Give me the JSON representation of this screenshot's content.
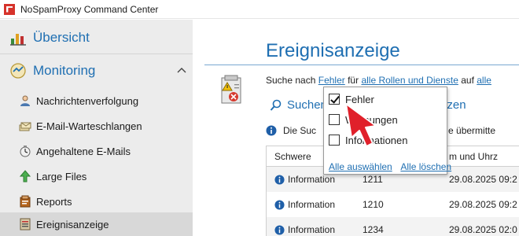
{
  "window": {
    "title": "NoSpamProxy Command Center"
  },
  "sidebar": {
    "overview": {
      "label": "Übersicht",
      "icon": "chart-icon"
    },
    "group": {
      "label": "Monitoring",
      "icon": "monitor-icon",
      "expanded": true
    },
    "items": [
      {
        "label": "Nachrichtenverfolgung",
        "icon": "message-tracking-icon",
        "active": false
      },
      {
        "label": "E-Mail-Warteschlangen",
        "icon": "mail-queue-icon",
        "active": false
      },
      {
        "label": "Angehaltene E-Mails",
        "icon": "held-mail-icon",
        "active": false
      },
      {
        "label": "Large Files",
        "icon": "large-files-icon",
        "active": false
      },
      {
        "label": "Reports",
        "icon": "reports-icon",
        "active": false
      },
      {
        "label": "Ereignisanzeige",
        "icon": "event-viewer-icon",
        "active": true
      }
    ]
  },
  "main": {
    "title": "Ereignisanzeige",
    "filter": {
      "prefix": "Suche nach",
      "severity_link": "Fehler",
      "mid": "für",
      "roles_link": "alle Rollen und Dienste",
      "suffix": "auf",
      "target_link": "alle"
    },
    "search_label_left": "Suchen",
    "search_label_right": "etzen",
    "info_left": "Die Suc",
    "info_right": "e übermitte",
    "table": {
      "columns": [
        "Schwere",
        "",
        "m und Uhrz"
      ],
      "rows": [
        {
          "severity": "Information",
          "id": "1211",
          "date": "29.08.2025 09:2"
        },
        {
          "severity": "Information",
          "id": "1210",
          "date": "29.08.2025 09:2"
        },
        {
          "severity": "Information",
          "id": "1234",
          "date": "29.08.2025 02:0"
        }
      ]
    }
  },
  "popup": {
    "options": [
      {
        "label": "Fehler",
        "checked": true
      },
      {
        "label": "Warnungen",
        "checked": false
      },
      {
        "label": "Informationen",
        "checked": false
      }
    ],
    "select_all": "Alle auswählen",
    "clear_all": "Alle löschen"
  },
  "colors": {
    "accent": "#1f6fb2",
    "sidebar_bg": "#ececec",
    "active_item": "#d8d8d8",
    "cursor": "#e0202a"
  }
}
